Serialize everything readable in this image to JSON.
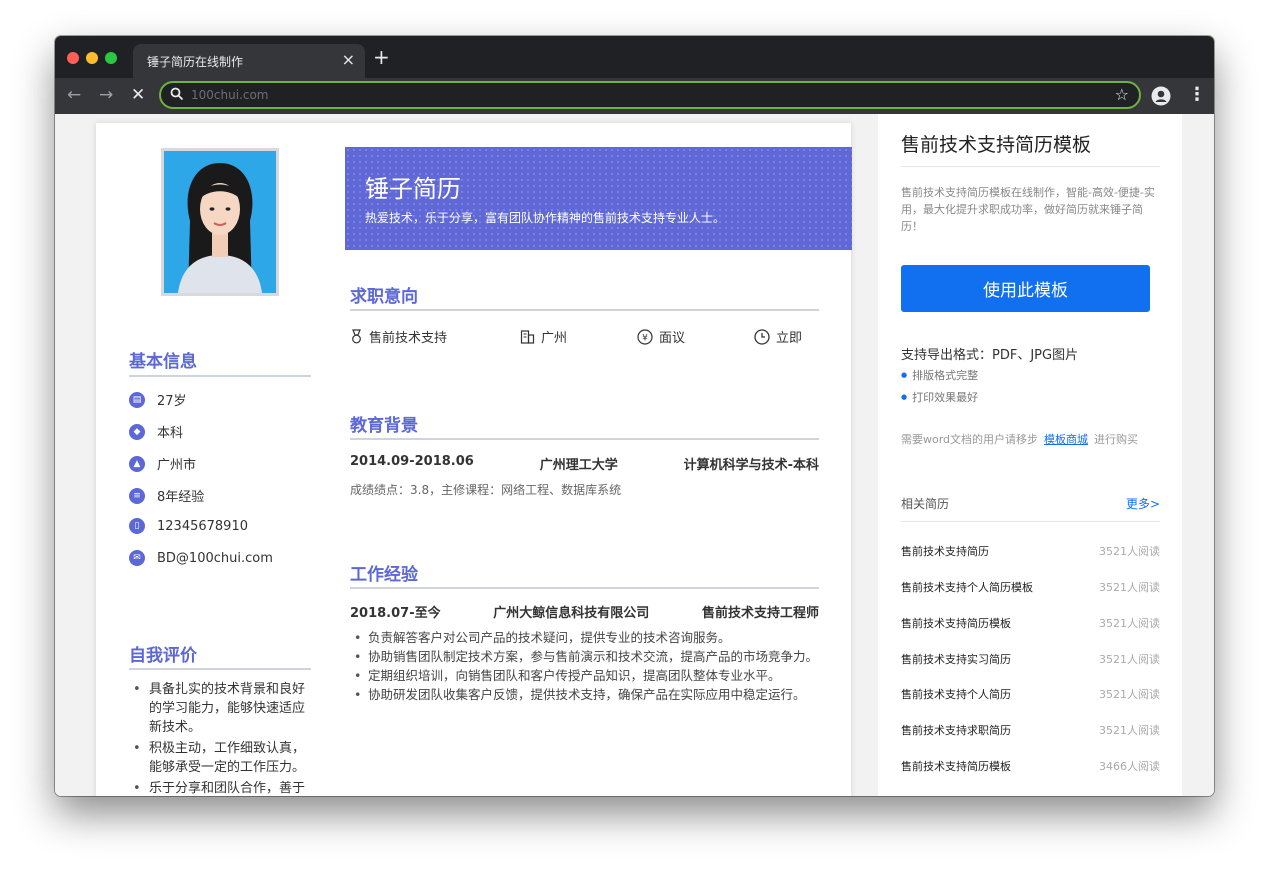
{
  "browser": {
    "tab_title": "锤子简历在线制作",
    "tab_close": "×",
    "new_tab": "+",
    "back": "←",
    "forward": "→",
    "stop": "✕",
    "url": "100chui.com",
    "bookmark_star": "☆",
    "menu": "⋮",
    "traffic_colors": [
      "#ff5f57",
      "#febc2e",
      "#28c840"
    ]
  },
  "resume": {
    "name": "锤子简历",
    "tagline": "热爱技术，乐于分享，富有团队协作精神的售前技术支持专业人士。",
    "basic_info": {
      "title": "基本信息",
      "items": [
        {
          "icon": "calendar-icon",
          "text": "27岁"
        },
        {
          "icon": "graduation-cap-icon",
          "text": "本科"
        },
        {
          "icon": "location-icon",
          "text": "广州市"
        },
        {
          "icon": "briefcase-icon",
          "text": "8年经验"
        },
        {
          "icon": "phone-icon",
          "text": "12345678910"
        },
        {
          "icon": "mail-icon",
          "text": "BD@100chui.com"
        }
      ]
    },
    "self_eval": {
      "title": "自我评价",
      "items": [
        "具备扎实的技术背景和良好的学习能力，能够快速适应新技术。",
        "积极主动，工作细致认真，能够承受一定的工作压力。",
        "乐于分享和团队合作，善于"
      ]
    },
    "intent": {
      "title": "求职意向",
      "position": "售前技术支持",
      "city": "广州",
      "salary": "面议",
      "availability": "立即"
    },
    "education": {
      "title": "教育背景",
      "period": "2014.09-2018.06",
      "school": "广州理工大学",
      "major": "计算机科学与技术-本科",
      "desc": "成绩绩点：3.8，主修课程：网络工程、数据库系统"
    },
    "work": {
      "title": "工作经验",
      "period": "2018.07-至今",
      "company": "广州大鲸信息科技有限公司",
      "role": "售前技术支持工程师",
      "items": [
        "负责解答客户对公司产品的技术疑问，提供专业的技术咨询服务。",
        "协助销售团队制定技术方案，参与售前演示和技术交流，提高产品的市场竞争力。",
        "定期组织培训，向销售团队和客户传授产品知识，提高团队整体专业水平。",
        "协助研发团队收集客户反馈，提供技术支持，确保产品在实际应用中稳定运行。"
      ]
    }
  },
  "sidebar": {
    "title": "售前技术支持简历模板",
    "desc": "售前技术支持简历模板在线制作，智能-高效-便捷-实用，最大化提升求职成功率，做好简历就来锤子简历！",
    "use_button": "使用此模板",
    "export_title": "支持导出格式：PDF、JPG图片",
    "export_items": [
      "排版格式完整",
      "打印效果最好"
    ],
    "word_prefix": "需要word文档的用户请移步",
    "word_link": "模板商城",
    "word_suffix": "进行购买",
    "related_title": "相关简历",
    "more_link": "更多>",
    "related": [
      {
        "name": "售前技术支持简历",
        "count": "3521人阅读"
      },
      {
        "name": "售前技术支持个人简历模板",
        "count": "3521人阅读"
      },
      {
        "name": "售前技术支持简历模板",
        "count": "3521人阅读"
      },
      {
        "name": "售前技术支持实习简历",
        "count": "3521人阅读"
      },
      {
        "name": "售前技术支持个人简历",
        "count": "3521人阅读"
      },
      {
        "name": "售前技术支持求职简历",
        "count": "3521人阅读"
      },
      {
        "name": "售前技术支持简历模板",
        "count": "3466人阅读"
      }
    ]
  }
}
